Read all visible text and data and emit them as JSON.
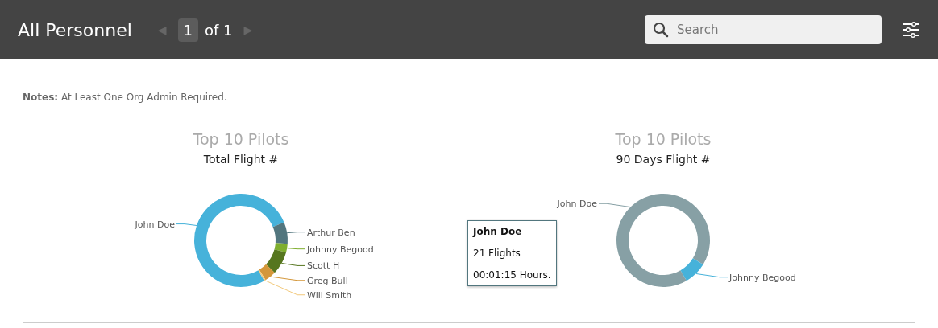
{
  "header": {
    "title": "All Personnel",
    "pager": {
      "prev": "◀",
      "page": "1",
      "of": "of 1",
      "next": "▶"
    },
    "search": {
      "placeholder": "Search"
    }
  },
  "notes": {
    "label": "Notes:",
    "text": "At Least One Org Admin Required."
  },
  "charts": [
    {
      "title": "Top 10 Pilots",
      "subtitle": "Total Flight #",
      "slices": [
        {
          "name": "John Doe",
          "color": "#46b2da"
        },
        {
          "name": "Arthur Ben",
          "color": "#52767e"
        },
        {
          "name": "Johnny Begood",
          "color": "#7fae2e"
        },
        {
          "name": "Scott H",
          "color": "#56761f"
        },
        {
          "name": "Greg Bull",
          "color": "#d4973a"
        },
        {
          "name": "Will Smith",
          "color": "#f2c97c"
        }
      ]
    },
    {
      "title": "Top 10 Pilots",
      "subtitle": "90 Days Flight #",
      "slices": [
        {
          "name": "John Doe",
          "color": "#87a0a5"
        },
        {
          "name": "Johnny Begood",
          "color": "#46b2da"
        }
      ],
      "tooltip": {
        "title": "John Doe",
        "lines": [
          "21 Flights",
          "00:01:15 Hours."
        ]
      }
    }
  ]
}
